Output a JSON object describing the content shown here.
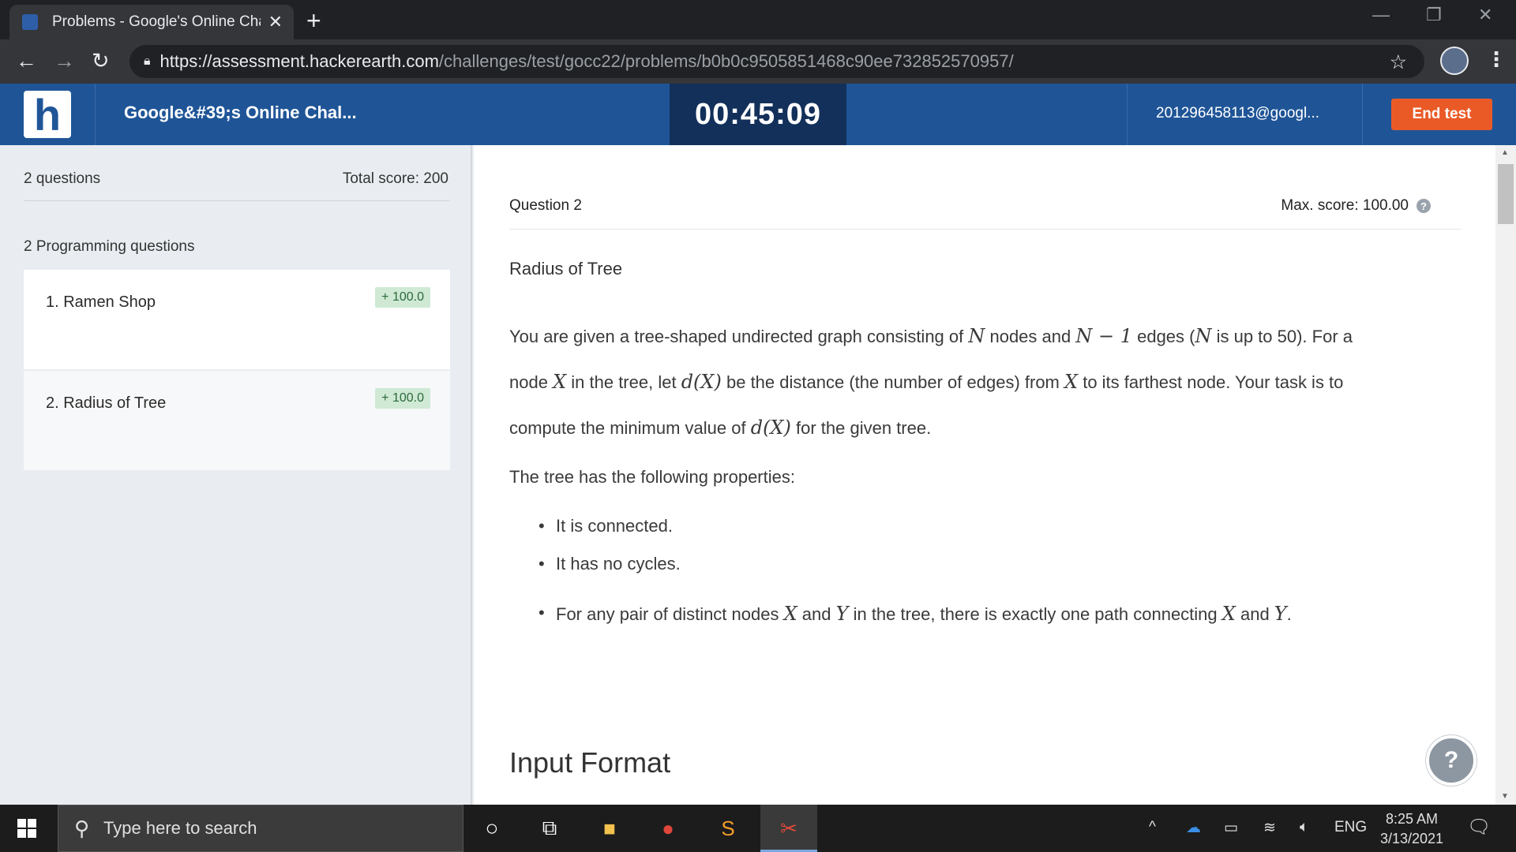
{
  "browser": {
    "tab_title": "Problems - Google's Online Chall",
    "url_host": "https://assessment.hackerearth.com",
    "url_path": "/challenges/test/gocc22/problems/b0b0c9505851468c90ee732852570957/"
  },
  "header": {
    "logo_letter": "h",
    "test_title": "Google&#39;s Online Chal...",
    "timer": "00:45:09",
    "email": "201296458113@googl...",
    "end_test_label": "End test"
  },
  "sidebar": {
    "question_count": "2 questions",
    "total_score": "Total score: 200",
    "section_label": "2 Programming questions",
    "questions": [
      {
        "label": "1.  Ramen Shop",
        "score": "+ 100.0"
      },
      {
        "label": "2.  Radius of Tree",
        "score": "+ 100.0"
      }
    ]
  },
  "question": {
    "number_label": "Question  2",
    "max_score": "Max. score: 100.00",
    "title": "Radius of Tree",
    "para1_line1": {
      "a": "You are given a tree-shaped undirected graph consisting of ",
      "m1": "N",
      "b": " nodes and ",
      "m2": "N − 1",
      "c": " edges (",
      "m3": "N",
      "d": " is up to 50). For a"
    },
    "para1_line2": {
      "a": "node ",
      "m1": "X",
      "b": " in the tree, let ",
      "m2": "d(X)",
      "c": " be the distance (the number of edges) from ",
      "m3": "X",
      "d": " to its farthest node. Your task is to"
    },
    "para1_line3": {
      "a": "compute the minimum value of ",
      "m1": "d(X)",
      "b": " for the given tree."
    },
    "para2": "The tree has the following properties:",
    "bullets": {
      "b1": "It is connected.",
      "b2": "It has no cycles.",
      "b3": {
        "a": "For any pair of distinct nodes ",
        "m1": "X",
        "b": " and ",
        "m2": "Y",
        "c": " in the tree, there is exactly one path connecting ",
        "m3": "X",
        "d": " and ",
        "m4": "Y",
        "e": "."
      }
    },
    "input_format_heading": "Input Format"
  },
  "taskbar": {
    "search_placeholder": "Type here to search",
    "language": "ENG",
    "time": "8:25 AM",
    "date": "3/13/2021"
  }
}
